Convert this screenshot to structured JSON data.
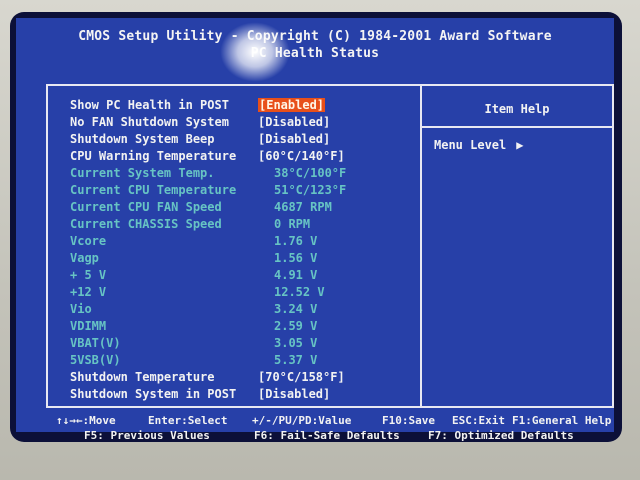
{
  "header": {
    "title": "CMOS Setup Utility - Copyright (C) 1984-2001 Award Software",
    "subtitle": "PC Health Status"
  },
  "help": {
    "title": "Item Help",
    "menu_level_label": "Menu Level",
    "menu_level_arrow": "▶"
  },
  "settings": [
    {
      "label": "Show PC Health in POST",
      "value": "[Enabled]",
      "kind": "selected"
    },
    {
      "label": "No FAN Shutdown System",
      "value": "[Disabled]",
      "kind": "editable"
    },
    {
      "label": "Shutdown System Beep",
      "value": "[Disabled]",
      "kind": "editable"
    },
    {
      "label": "CPU Warning Temperature",
      "value": "[60°C/140°F]",
      "kind": "editable"
    },
    {
      "label": "Current System Temp.",
      "value": "38°C/100°F",
      "kind": "readonly"
    },
    {
      "label": "Current CPU Temperature",
      "value": "51°C/123°F",
      "kind": "readonly"
    },
    {
      "label": "Current CPU FAN Speed",
      "value": "4687 RPM",
      "kind": "readonly"
    },
    {
      "label": "Current CHASSIS Speed",
      "value": "0 RPM",
      "kind": "readonly"
    },
    {
      "label": "Vcore",
      "value": "1.76 V",
      "kind": "readonly"
    },
    {
      "label": "Vagp",
      "value": "1.56 V",
      "kind": "readonly"
    },
    {
      "label": "+ 5 V",
      "value": "4.91 V",
      "kind": "readonly"
    },
    {
      "label": "+12 V",
      "value": "12.52 V",
      "kind": "readonly"
    },
    {
      "label": "Vio",
      "value": "3.24 V",
      "kind": "readonly"
    },
    {
      "label": "VDIMM",
      "value": "2.59 V",
      "kind": "readonly"
    },
    {
      "label": "VBAT(V)",
      "value": "3.05 V",
      "kind": "readonly"
    },
    {
      "label": "5VSB(V)",
      "value": "5.37 V",
      "kind": "readonly"
    },
    {
      "label": "Shutdown Temperature",
      "value": "[70°C/158°F]",
      "kind": "editable"
    },
    {
      "label": "Shutdown System in POST",
      "value": "[Disabled]",
      "kind": "editable"
    }
  ],
  "footer": {
    "move": "↑↓→←:Move",
    "select": "Enter:Select",
    "value": "+/-/PU/PD:Value",
    "save": "F10:Save",
    "exit": "ESC:Exit",
    "general_help": "F1:General Help",
    "previous": "F5: Previous Values",
    "failsafe": "F6: Fail-Safe Defaults",
    "optimized": "F7: Optimized Defaults"
  },
  "colors": {
    "bios_blue": "#2740a8",
    "dim_cyan": "#67c4c4",
    "selection": "#e8501a",
    "text": "#f2f2f2"
  }
}
